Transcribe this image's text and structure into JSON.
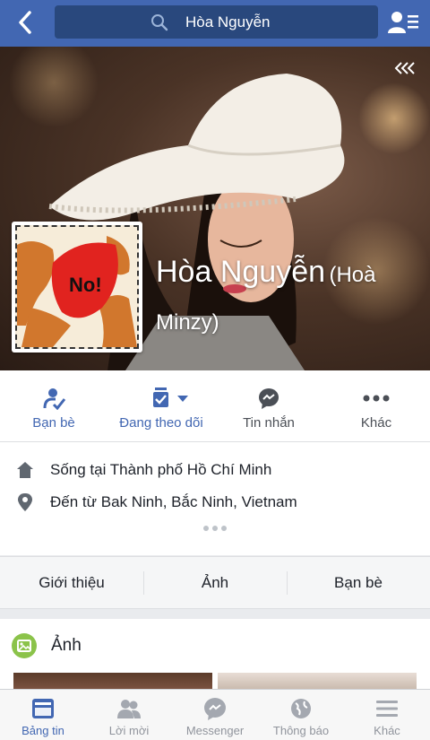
{
  "header": {
    "search_value": "Hòa Nguyễn",
    "icons": {
      "back": "back-arrow-icon",
      "search": "search-icon",
      "friends_list": "friends-list-icon"
    }
  },
  "cover": {
    "collapse_icon": "collapse-chevrons-icon",
    "avatar_text": "No!"
  },
  "profile": {
    "name": "Hòa Nguyễn",
    "alt_name": "(Hoà Minzy)"
  },
  "actions": [
    {
      "label": "Bạn bè",
      "icon": "friends-check-icon"
    },
    {
      "label": "Đang theo dõi",
      "icon": "following-icon"
    },
    {
      "label": "Tin nhắn",
      "icon": "messenger-icon"
    },
    {
      "label": "Khác",
      "icon": "more-dots-icon"
    }
  ],
  "info": {
    "lives_in": "Sống tại Thành phố Hồ Chí Minh",
    "from": "Đến từ Bak Ninh, Bắc Ninh, Vietnam"
  },
  "tabs": [
    "Giới thiệu",
    "Ảnh",
    "Bạn bè"
  ],
  "photos_section": {
    "title": "Ảnh"
  },
  "bottom_nav": [
    {
      "label": "Bảng tin",
      "icon": "news-feed-icon",
      "active": true
    },
    {
      "label": "Lời mời",
      "icon": "friend-requests-icon",
      "active": false
    },
    {
      "label": "Messenger",
      "icon": "messenger-icon",
      "active": false
    },
    {
      "label": "Thông báo",
      "icon": "globe-icon",
      "active": false
    },
    {
      "label": "Khác",
      "icon": "menu-icon",
      "active": false
    }
  ],
  "colors": {
    "brand": "#4267b2",
    "header_dark": "#29487d",
    "inactive": "#90949c"
  }
}
